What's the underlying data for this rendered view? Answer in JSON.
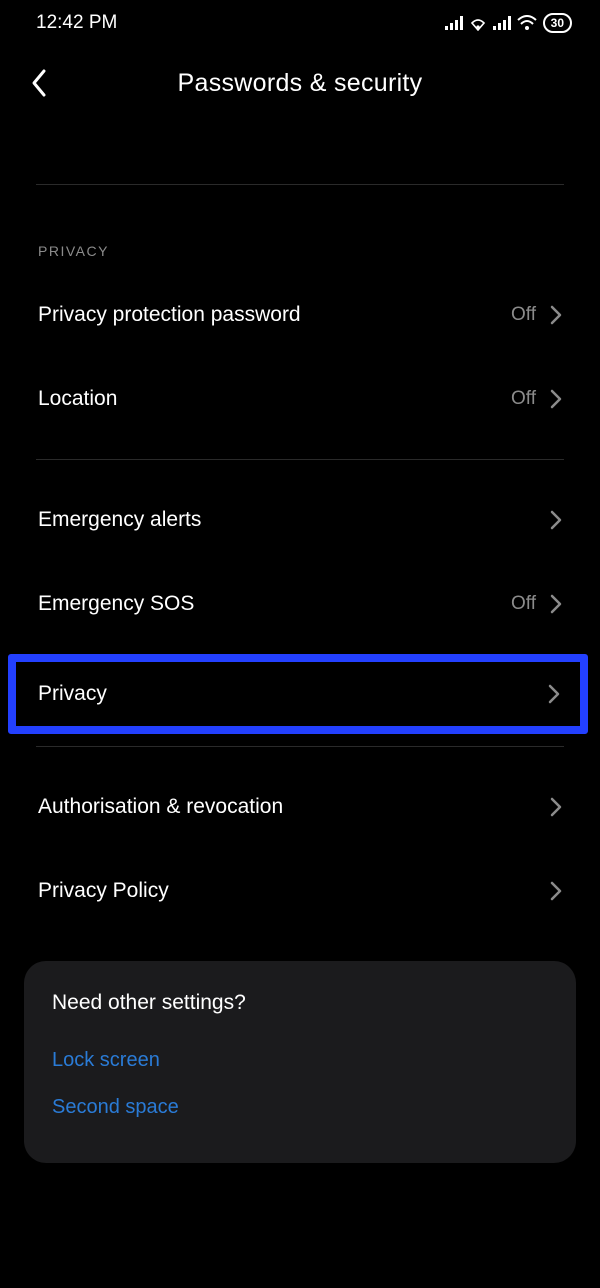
{
  "status": {
    "time": "12:42 PM",
    "battery": "30"
  },
  "header": {
    "title": "Passwords & security"
  },
  "section": {
    "privacy_label": "PRIVACY"
  },
  "rows": {
    "privacy_protection": {
      "label": "Privacy protection password",
      "value": "Off"
    },
    "location": {
      "label": "Location",
      "value": "Off"
    },
    "emergency_alerts": {
      "label": "Emergency alerts"
    },
    "emergency_sos": {
      "label": "Emergency SOS",
      "value": "Off"
    },
    "privacy": {
      "label": "Privacy"
    },
    "authorisation": {
      "label": "Authorisation & revocation"
    },
    "privacy_policy": {
      "label": "Privacy Policy"
    }
  },
  "card": {
    "title": "Need other settings?",
    "links": {
      "lock_screen": "Lock screen",
      "second_space": "Second space"
    }
  }
}
